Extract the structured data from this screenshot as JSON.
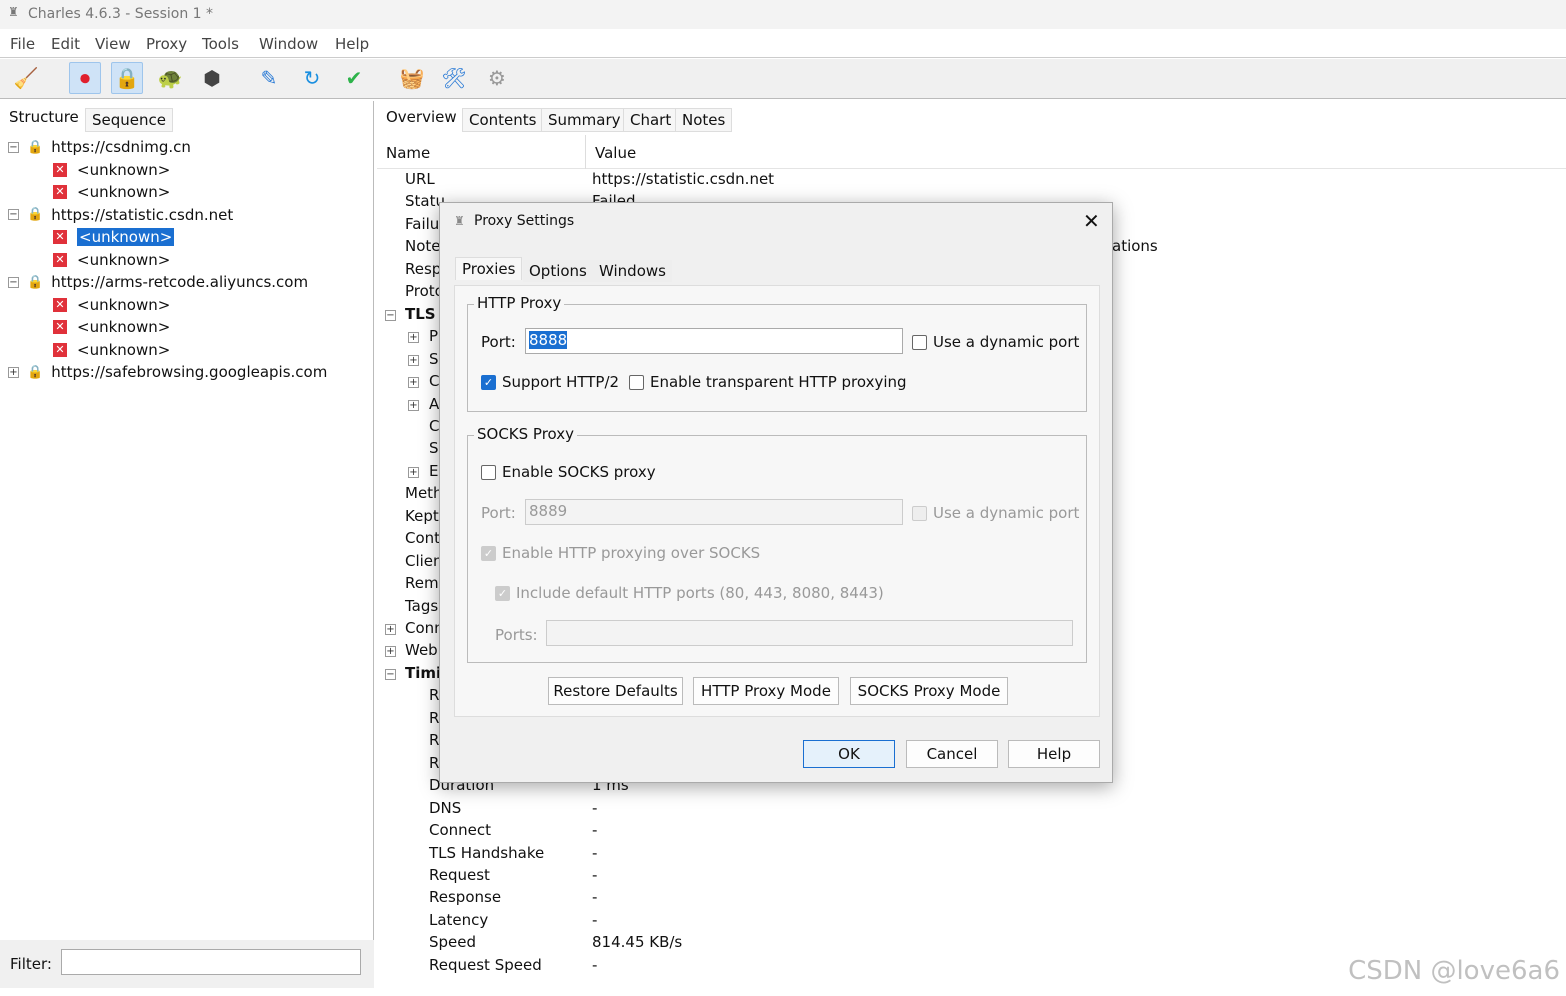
{
  "window": {
    "title": "Charles 4.6.3 - Session 1 *"
  },
  "menu": [
    "File",
    "Edit",
    "View",
    "Proxy",
    "Tools",
    "Window",
    "Help"
  ],
  "toolbar": [
    {
      "icon": "broom-icon",
      "g": "🧹"
    },
    {
      "icon": "record-icon",
      "g": "⏺",
      "on": true
    },
    {
      "icon": "ssl-proxy-lock-icon",
      "g": "🔒",
      "on": true
    },
    {
      "icon": "throttle-turtle-icon",
      "g": "🐢"
    },
    {
      "icon": "breakpoint-stop-icon",
      "g": "⬢"
    },
    {
      "icon": "compose-pen-icon",
      "g": "✎"
    },
    {
      "icon": "repeat-refresh-icon",
      "g": "↻"
    },
    {
      "icon": "validate-check-icon",
      "g": "✔"
    },
    {
      "icon": "basket-icon",
      "g": "🧺"
    },
    {
      "icon": "tools-icon",
      "g": "🛠"
    },
    {
      "icon": "settings-gear-icon",
      "g": "⚙"
    }
  ],
  "left": {
    "tabs": [
      "Structure",
      "Sequence"
    ],
    "tree": [
      {
        "label": "https://csdnimg.cn",
        "type": "host",
        "toggle": "−"
      },
      {
        "label": "<unknown>",
        "type": "err"
      },
      {
        "label": "<unknown>",
        "type": "err"
      },
      {
        "label": "https://statistic.csdn.net",
        "type": "host",
        "toggle": "−"
      },
      {
        "label": "<unknown>",
        "type": "err",
        "selected": true
      },
      {
        "label": "<unknown>",
        "type": "err"
      },
      {
        "label": "https://arms-retcode.aliyuncs.com",
        "type": "host",
        "toggle": "−"
      },
      {
        "label": "<unknown>",
        "type": "err"
      },
      {
        "label": "<unknown>",
        "type": "err"
      },
      {
        "label": "<unknown>",
        "type": "err"
      },
      {
        "label": "https://safebrowsing.googleapis.com",
        "type": "host",
        "toggle": "+"
      }
    ],
    "filter_label": "Filter:",
    "filter_value": ""
  },
  "right": {
    "tabs": [
      "Overview",
      "Contents",
      "Summary",
      "Chart",
      "Notes"
    ],
    "columns": [
      "Name",
      "Value"
    ],
    "rows": [
      {
        "n": "URL",
        "v": "https://statistic.csdn.net"
      },
      {
        "n": "Statu",
        "v": "Failed"
      },
      {
        "n": "Failu",
        "v": ""
      },
      {
        "n": "Note",
        "v": "ations"
      },
      {
        "n": "Resp",
        "v": ""
      },
      {
        "n": "Proto",
        "v": ""
      },
      {
        "n": "TLS",
        "v": "",
        "t": "−",
        "bold": true
      },
      {
        "n": "P",
        "v": "",
        "t": "+",
        "i": 1
      },
      {
        "n": "S",
        "v": "",
        "t": "+",
        "i": 1
      },
      {
        "n": "C",
        "v": "",
        "t": "+",
        "i": 1
      },
      {
        "n": "A",
        "v": "",
        "t": "+",
        "i": 1
      },
      {
        "n": "C",
        "v": "",
        "i": 1
      },
      {
        "n": "S",
        "v": "",
        "i": 1
      },
      {
        "n": "E",
        "v": "",
        "t": "+",
        "i": 1
      },
      {
        "n": "Meth",
        "v": ""
      },
      {
        "n": "Kept",
        "v": ""
      },
      {
        "n": "Cont",
        "v": ""
      },
      {
        "n": "Clien",
        "v": ""
      },
      {
        "n": "Rem",
        "v": ""
      },
      {
        "n": "Tags",
        "v": ""
      },
      {
        "n": "Conn",
        "v": "",
        "t": "+"
      },
      {
        "n": "Web",
        "v": "",
        "t": "+"
      },
      {
        "n": "Timi",
        "v": "",
        "t": "−",
        "bold": true
      },
      {
        "n": "R",
        "v": "",
        "i": 1
      },
      {
        "n": "R",
        "v": "",
        "i": 1
      },
      {
        "n": "R",
        "v": "",
        "i": 1
      },
      {
        "n": "R",
        "v": "",
        "i": 1
      },
      {
        "n": "Duration",
        "v": "1 ms",
        "i": 1
      },
      {
        "n": "DNS",
        "v": "-",
        "i": 1
      },
      {
        "n": "Connect",
        "v": "-",
        "i": 1
      },
      {
        "n": "TLS Handshake",
        "v": "-",
        "i": 1
      },
      {
        "n": "Request",
        "v": "-",
        "i": 1
      },
      {
        "n": "Response",
        "v": "-",
        "i": 1
      },
      {
        "n": "Latency",
        "v": "-",
        "i": 1
      },
      {
        "n": "Speed",
        "v": "814.45 KB/s",
        "i": 1
      },
      {
        "n": "Request Speed",
        "v": "-",
        "i": 1
      }
    ]
  },
  "dialog": {
    "title": "Proxy Settings",
    "tabs": [
      "Proxies",
      "Options",
      "Windows"
    ],
    "http": {
      "title": "HTTP Proxy",
      "port_label": "Port:",
      "port": "8888",
      "dynamic": "Use a dynamic port",
      "http2": "Support HTTP/2",
      "transparent": "Enable transparent HTTP proxying"
    },
    "socks": {
      "title": "SOCKS Proxy",
      "enable": "Enable SOCKS proxy",
      "port_label": "Port:",
      "port": "8889",
      "dynamic": "Use a dynamic port",
      "over": "Enable HTTP proxying over SOCKS",
      "include": "Include default HTTP ports (80, 443, 8080, 8443)",
      "ports_label": "Ports:",
      "ports": ""
    },
    "buttons": {
      "restore": "Restore Defaults",
      "http_mode": "HTTP Proxy Mode",
      "socks_mode": "SOCKS Proxy Mode",
      "ok": "OK",
      "cancel": "Cancel",
      "help": "Help"
    }
  },
  "watermark": "CSDN @love6a6"
}
